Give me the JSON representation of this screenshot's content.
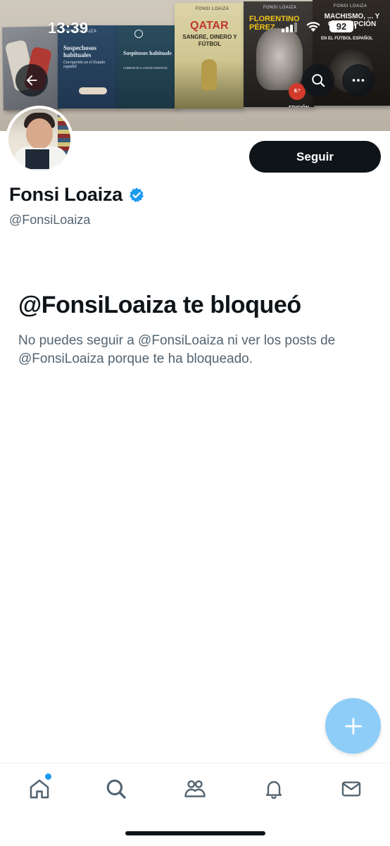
{
  "status_bar": {
    "time": "13:39",
    "battery": "92"
  },
  "banner": {
    "books": [
      {
        "author": "",
        "title": "",
        "subtitle": ""
      },
      {
        "author": "FONSI LOAIZA",
        "title": "Sospechosos habituales",
        "subtitle": "Corrupción en el Estado español"
      },
      {
        "author": "",
        "title": "Sospitosos habituals",
        "subtitle": "CORRUPCIÓ A L'ESTAT ESPANYOL"
      },
      {
        "author": "FONSI LOAIZA",
        "title": "QATAR",
        "subtitle": "SANGRE, DINERO Y FÚTBOL"
      },
      {
        "author": "FONSI LOAIZA",
        "title": "FLORENTINO PÉREZ",
        "subtitle": "8.ª EDICIÓN"
      },
      {
        "author": "FONSI LOAIZA",
        "title": "MACHISMO, ... Y CORRUPCIÓN",
        "subtitle": "EN EL FÚTBOL ESPAÑOL"
      }
    ]
  },
  "header": {
    "back_icon": "arrow-left-icon",
    "search_icon": "search-icon",
    "more_icon": "more-horizontal-icon"
  },
  "profile": {
    "follow_label": "Seguir",
    "display_name": "Fonsi Loaiza",
    "verified": true,
    "handle": "@FonsiLoaiza"
  },
  "blocked": {
    "title": "@FonsiLoaiza te bloqueó",
    "description": "No puedes seguir a @FonsiLoaiza ni ver los posts de @FonsiLoaiza porque te ha bloqueado."
  },
  "fab": {
    "icon": "plus-icon"
  },
  "bottom_nav": {
    "items": [
      {
        "id": "home",
        "icon": "home-icon",
        "has_dot": true
      },
      {
        "id": "search",
        "icon": "search-icon"
      },
      {
        "id": "communities",
        "icon": "communities-icon"
      },
      {
        "id": "notifications",
        "icon": "bell-icon"
      },
      {
        "id": "messages",
        "icon": "mail-icon"
      }
    ]
  },
  "colors": {
    "primary_text": "#0f1419",
    "secondary_text": "#536471",
    "accent": "#1d9bf0",
    "fab": "#8ecdf8",
    "follow_button": "#0f1419"
  }
}
